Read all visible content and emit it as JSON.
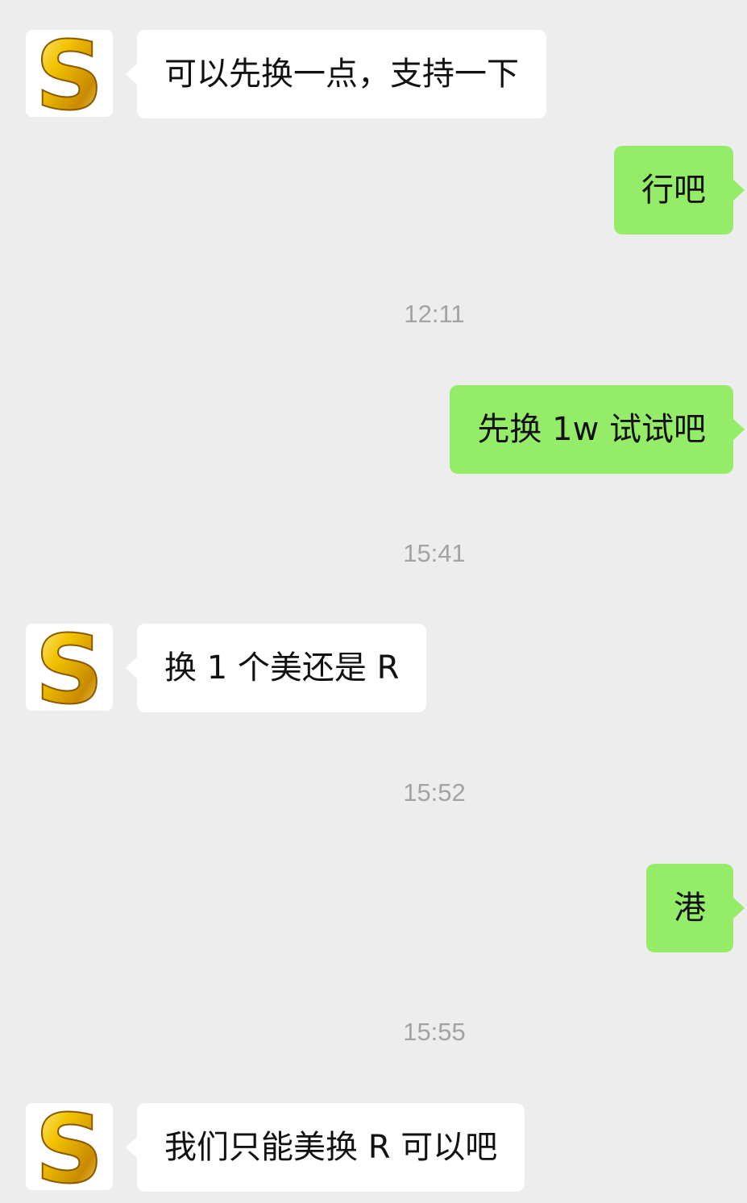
{
  "colors": {
    "background": "#ededed",
    "incoming_bubble": "#ffffff",
    "outgoing_bubble": "#95ec69",
    "timestamp_text": "#a3a3a3",
    "avatar_gold": "#f2c200"
  },
  "contact": {
    "avatar_icon": "gold-letter-s-icon",
    "avatar_letter": "S"
  },
  "messages": [
    {
      "type": "incoming",
      "text": "可以先换一点，支持一下"
    },
    {
      "type": "outgoing",
      "text": "行吧"
    },
    {
      "type": "time",
      "text": "12:11"
    },
    {
      "type": "outgoing",
      "text": "先换 1w 试试吧"
    },
    {
      "type": "time",
      "text": "15:41"
    },
    {
      "type": "incoming",
      "text": "换 1 个美还是 R"
    },
    {
      "type": "time",
      "text": "15:52"
    },
    {
      "type": "outgoing",
      "text": "港"
    },
    {
      "type": "time",
      "text": "15:55"
    },
    {
      "type": "incoming",
      "text": "我们只能美换 R 可以吧"
    }
  ]
}
